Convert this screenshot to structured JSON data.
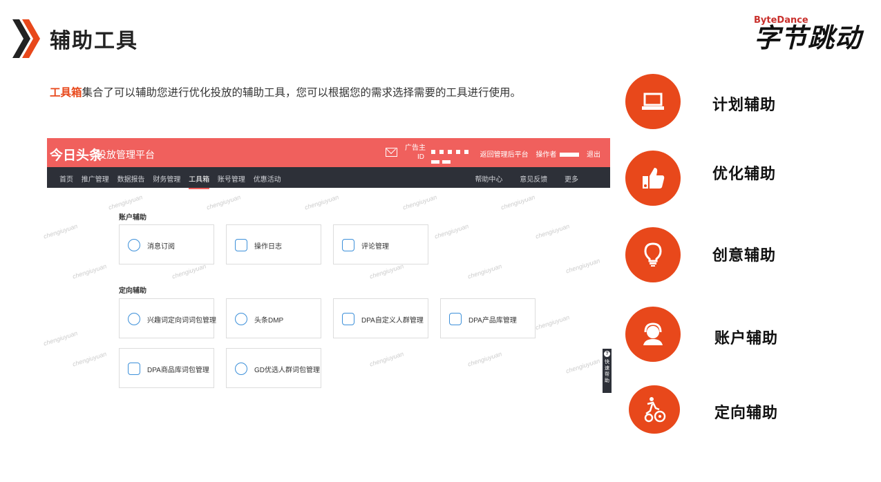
{
  "slide": {
    "title": "辅助工具",
    "logo_en": "ByteDance",
    "logo_cn": "字节跳动",
    "intro_highlight": "工具箱",
    "intro_rest": "集合了可以辅助您进行优化投放的辅助工具，您可以根据您的需求选择需要的工具进行使用。"
  },
  "app": {
    "brand": "今日头条",
    "platform": "投放管理平台",
    "advertiser_label": "广告主",
    "advertiser_id_label": "ID",
    "back_link": "返回管理后平台",
    "operator_label": "操作者",
    "logout": "退出",
    "nav_left": [
      "首页",
      "推广管理",
      "数据报告",
      "财务管理",
      "工具箱",
      "账号管理",
      "优惠活动"
    ],
    "nav_right": [
      "帮助中心",
      "意见反馈",
      "更多"
    ],
    "section_account": "账户辅助",
    "section_targeting": "定向辅助",
    "account_tools": [
      "消息订阅",
      "操作日志",
      "评论管理"
    ],
    "targeting_tools": [
      "兴趣词定向词词包管理",
      "头条DMP",
      "DPA自定义人群管理",
      "DPA产品库管理",
      "DPA商品库词包管理",
      "GD优选人群词包管理"
    ],
    "watermark": "chengiuyuan",
    "quick_help": "快速帮助"
  },
  "features": [
    {
      "label": "计划辅助",
      "icon": "laptop-icon"
    },
    {
      "label": "优化辅助",
      "icon": "thumbs-up-icon"
    },
    {
      "label": "创意辅助",
      "icon": "lightbulb-icon"
    },
    {
      "label": "账户辅助",
      "icon": "headset-user-icon"
    },
    {
      "label": "定向辅助",
      "icon": "runner-gear-icon"
    }
  ],
  "colors": {
    "accent": "#e8481b",
    "app_header": "#f0605d",
    "app_nav": "#2d3038"
  }
}
